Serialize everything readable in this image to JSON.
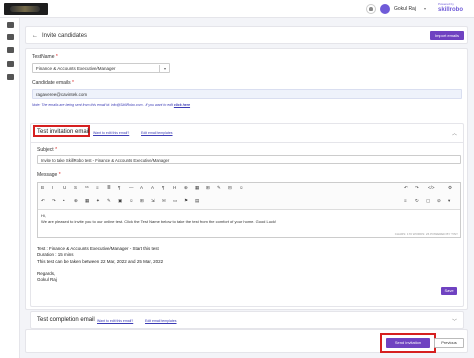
{
  "header": {
    "user_name": "Gokul Raj",
    "user_caret": "▾",
    "brand_small": "Powered by",
    "brand_main": "skillrobo"
  },
  "page": {
    "back_arrow": "←",
    "title": "Invite candidates",
    "import_label": "Import emails"
  },
  "form": {
    "testname_label": "TestName",
    "required_mark": "*",
    "testname_value": "Finance & Accounts Executive/Manager",
    "select_caret": "▾",
    "emails_label": "Candidate emails",
    "emails_value": "ragaveree@cavintek.com",
    "note_text": "Note: The emails are being sent from this email id: info@SkillRobo.com . If you want to edit ",
    "note_link": "click here"
  },
  "invite_section": {
    "title": "Test invitation email",
    "link_edit_mail": "Want to edit this email?",
    "link_edit_template": "Edit email templates",
    "chevron": "︿",
    "subject_label": "Subject",
    "subject_value": "Invite to take SkillRobo test - Finance & Accounts Executive/Manager",
    "message_label": "Message",
    "toolbar_row1": [
      "B",
      "I",
      "U",
      "S",
      "⁶⁶",
      "≡",
      "≣",
      "¶",
      "—",
      "A",
      "A",
      "¶",
      "H",
      "⊕",
      "▦",
      "⊞",
      "✎",
      "⊟",
      "☺",
      "↶",
      "↷",
      "</>",
      "⚙"
    ],
    "toolbar_row2": [
      "↶",
      "↷",
      "•",
      "⊕",
      "▦",
      "✦",
      "✎",
      "▣",
      "☺",
      "⊞",
      "⇲",
      "✉",
      "▭",
      "⚑",
      "▤",
      "≡",
      "↻",
      "▢",
      "⊘",
      "▾"
    ],
    "editor_line1": "Hi,",
    "editor_line2": "We are pleased to invite you to our online test. Click the Test Name below to take the test from the comfort of your home. Good Luck!",
    "editor_status": "CHARS: 170   WORDS: 26   POWERED BY TINY",
    "preview_line1": "Test : Finance & Accounts Executive/Manager - Start this test",
    "preview_line2": "Duration : 15 mins",
    "preview_line3": "This test can be taken between 22 Mar, 2022 and  25 Mar, 2022",
    "preview_line4": "Regards,",
    "preview_line5": "Gokul Raj",
    "save_label": "Save"
  },
  "completion_section": {
    "title": "Test completion email",
    "link_edit_mail": "Want to edit this email?",
    "link_edit_template": "Edit email templates",
    "chevron": "﹀"
  },
  "footer": {
    "send_label": "Send invitation",
    "previous_label": "Previous"
  },
  "colors": {
    "accent": "#6f42c1",
    "highlight": "#d62020",
    "link": "#3b3bb5"
  }
}
